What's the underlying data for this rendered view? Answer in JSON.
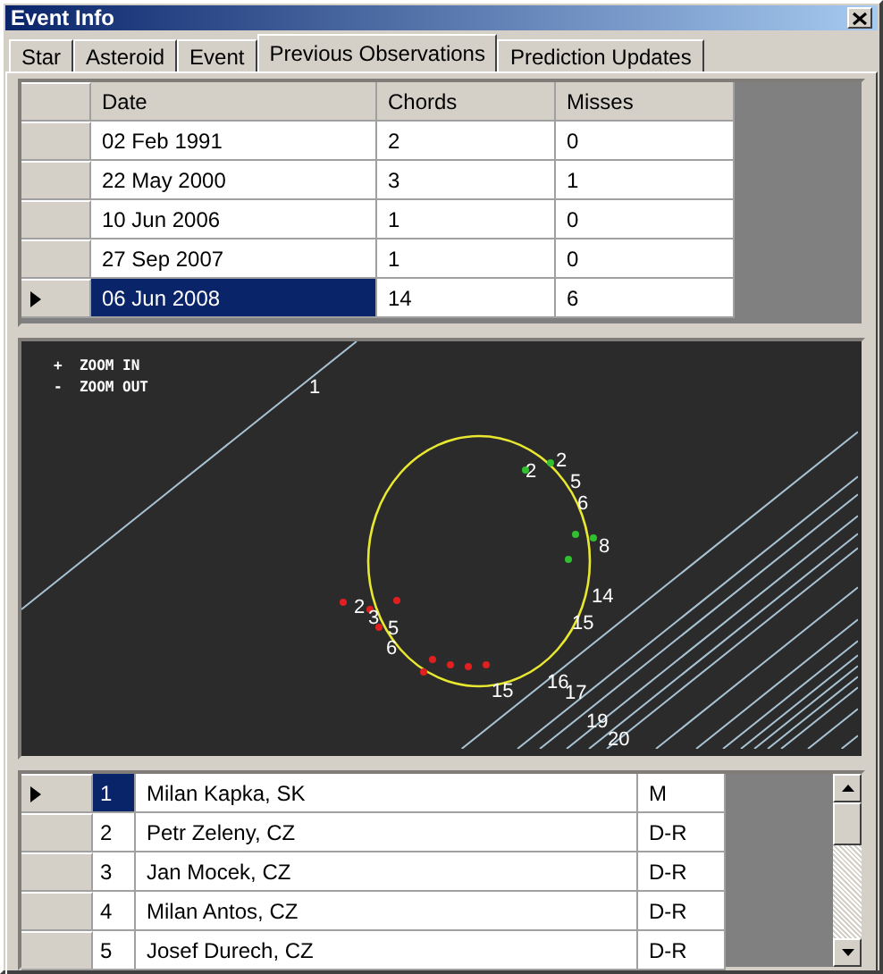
{
  "window": {
    "title": "Event Info"
  },
  "tabs": [
    {
      "label": "Star",
      "selected": false
    },
    {
      "label": "Asteroid",
      "selected": false
    },
    {
      "label": "Event",
      "selected": false
    },
    {
      "label": "Previous Observations",
      "selected": true
    },
    {
      "label": "Prediction Updates",
      "selected": false
    }
  ],
  "observations": {
    "columns": [
      "Date",
      "Chords",
      "Misses"
    ],
    "rows": [
      {
        "cells": [
          "02 Feb 1991",
          "2",
          "0"
        ],
        "selected": false
      },
      {
        "cells": [
          "22 May 2000",
          "3",
          "1"
        ],
        "selected": false
      },
      {
        "cells": [
          "10 Jun 2006",
          "1",
          "0"
        ],
        "selected": false
      },
      {
        "cells": [
          "27 Sep 2007",
          "1",
          "0"
        ],
        "selected": false
      },
      {
        "cells": [
          "06 Jun 2008",
          "14",
          "6"
        ],
        "selected": true
      }
    ]
  },
  "plot": {
    "zoom_hints": [
      "+  ZOOM IN",
      "-  ZOOM OUT"
    ],
    "chord_labels": [
      "1",
      "2",
      "2",
      "5",
      "6",
      "8",
      "14",
      "15",
      "2",
      "3",
      "5",
      "6",
      "15",
      "16",
      "17",
      "19",
      "20"
    ]
  },
  "observers": {
    "rows": [
      {
        "number": "1",
        "name": "Milan Kapka, SK",
        "type": "M",
        "selected": true
      },
      {
        "number": "2",
        "name": "Petr Zeleny, CZ",
        "type": "D-R",
        "selected": false
      },
      {
        "number": "3",
        "name": "Jan Mocek, CZ",
        "type": "D-R",
        "selected": false
      },
      {
        "number": "4",
        "name": "Milan Antos, CZ",
        "type": "D-R",
        "selected": false
      },
      {
        "number": "5",
        "name": "Josef Durech, CZ",
        "type": "D-R",
        "selected": false
      }
    ]
  }
}
